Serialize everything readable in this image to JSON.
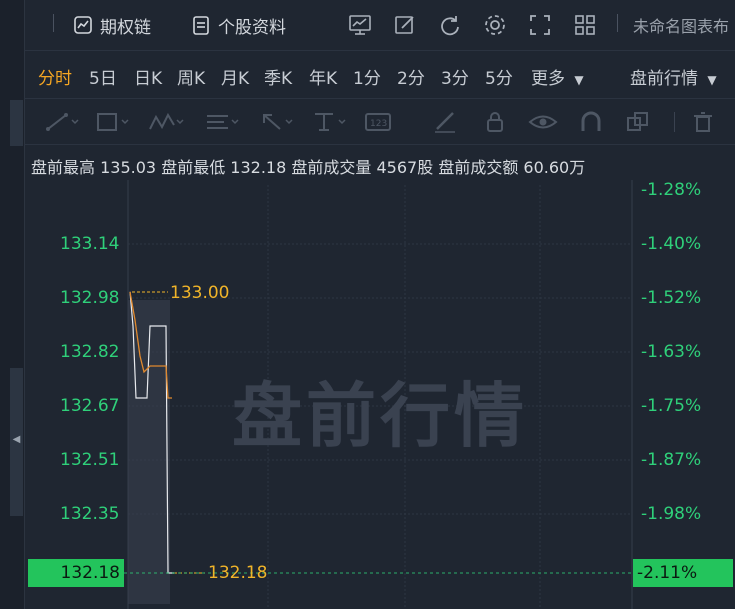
{
  "toolbar": {
    "option_chain": "期权链",
    "stock_profile": "个股资料",
    "template_name": "未命名图表布"
  },
  "tabs": {
    "intraday": "分时",
    "day5": "5日",
    "daily": "日K",
    "weekly": "周K",
    "monthly": "月K",
    "quarterly": "季K",
    "yearly": "年K",
    "min1": "1分",
    "min2": "2分",
    "min3": "3分",
    "min5": "5分",
    "more": "更多",
    "session": "盘前行情"
  },
  "info": {
    "high_label": "盘前最高",
    "high_value": "135.03",
    "low_label": "盘前最低",
    "low_value": "132.18",
    "vol_label": "盘前成交量",
    "vol_value": "4567股",
    "amt_label": "盘前成交额",
    "amt_value": "60.60万"
  },
  "chart_data": {
    "type": "line",
    "watermark": "盘前行情",
    "price_ticks": [
      "133.14",
      "132.98",
      "132.82",
      "132.67",
      "132.51",
      "132.35"
    ],
    "pct_ticks": [
      "-1.28%",
      "-1.40%",
      "-1.52%",
      "-1.63%",
      "-1.75%",
      "-1.87%",
      "-1.98%"
    ],
    "current_price": "132.18",
    "current_pct": "-2.11%",
    "peak_label": "133.00",
    "low_label": "132.18",
    "ylim": [
      132.18,
      135.03
    ],
    "series": [
      {
        "values": [
          133.0,
          132.9,
          132.7,
          132.7,
          132.8,
          132.86,
          132.86,
          132.18,
          132.18
        ]
      },
      {
        "values": [
          133.0,
          132.85,
          132.78,
          132.74,
          132.76,
          132.76,
          132.76,
          132.7
        ]
      }
    ]
  },
  "colors": {
    "green": "#2fd07a",
    "accent": "#f5a623",
    "price_line": "#e8eaee",
    "avg_line": "#e0892e"
  }
}
